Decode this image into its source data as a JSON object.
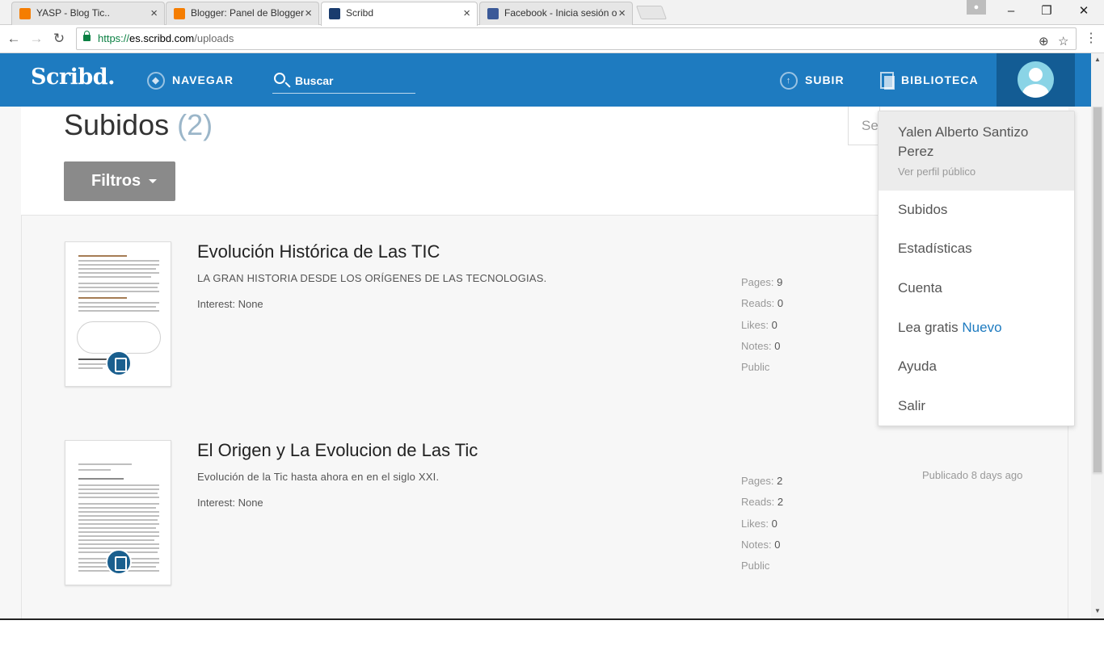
{
  "browser": {
    "tabs": [
      {
        "title": "YASP - Blog Tic..",
        "icon": "blogger-favicon",
        "color": "#f57d00"
      },
      {
        "title": "Blogger: Panel de Blogger",
        "icon": "blogger-favicon",
        "color": "#f57d00"
      },
      {
        "title": "Scribd",
        "icon": "scribd-favicon",
        "color": "#1a3c6e",
        "active": true
      },
      {
        "title": "Facebook - Inicia sesión o",
        "icon": "facebook-favicon",
        "color": "#3b5998"
      }
    ],
    "close_glyph": "×",
    "url": {
      "secure": "https://",
      "domain": "es.scribd.com",
      "path": "/uploads"
    },
    "window_controls": {
      "minimize": "–",
      "maximize": "❐",
      "close": "✕"
    }
  },
  "header": {
    "logo": "Scribd.",
    "browse": "NAVEGAR",
    "search_placeholder": "Buscar",
    "upload": "SUBIR",
    "library": "BIBLIOTECA",
    "color": "#1e7bc0"
  },
  "page": {
    "title": "Subidos",
    "count": "(2)",
    "filters_button": "Filtros",
    "sort_partial": "Se"
  },
  "documents": [
    {
      "title": "Evolución Histórica de Las TIC",
      "description": "LA GRAN HISTORIA DESDE LOS ORÍGENES DE LAS TECNOLOGIAS.",
      "interest": "Interest: None",
      "pages_label": "Pages: ",
      "pages": "9",
      "reads_label": "Reads: ",
      "reads": "0",
      "likes_label": "Likes: ",
      "likes": "0",
      "notes_label": "Notes: ",
      "notes": "0",
      "visibility": "Public",
      "published": ""
    },
    {
      "title": "El Origen y La Evolucion de Las Tic",
      "description": "Evolución de la Tic hasta ahora en en el siglo XXI.",
      "interest": "Interest: None",
      "pages_label": "Pages: ",
      "pages": "2",
      "reads_label": "Reads: ",
      "reads": "2",
      "likes_label": "Likes: ",
      "likes": "0",
      "notes_label": "Notes: ",
      "notes": "0",
      "visibility": "Public",
      "published": "Publicado 8 days ago"
    }
  ],
  "user_menu": {
    "name": "Yalen Alberto Santizo Perez",
    "profile_link": "Ver perfil público",
    "items": [
      "Subidos",
      "Estadísticas",
      "Cuenta"
    ],
    "free_read": "Lea gratis",
    "free_read_badge": "Nuevo",
    "help": "Ayuda",
    "logout": "Salir"
  }
}
